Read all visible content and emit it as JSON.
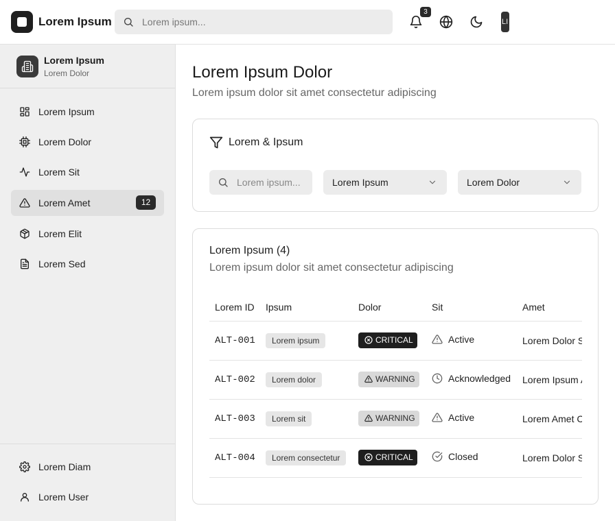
{
  "app": {
    "title": "Lorem Ipsum"
  },
  "search": {
    "placeholder": "Lorem ipsum..."
  },
  "topbar": {
    "notification_count": "3",
    "avatar_initials": "LI"
  },
  "sidebar": {
    "org": {
      "name": "Lorem Ipsum",
      "subtitle": "Lorem Dolor"
    },
    "items": [
      {
        "label": "Lorem Ipsum",
        "icon": "dashboard-icon"
      },
      {
        "label": "Lorem Dolor",
        "icon": "chip-icon"
      },
      {
        "label": "Lorem Sit",
        "icon": "activity-icon"
      },
      {
        "label": "Lorem Amet",
        "icon": "alert-triangle-icon",
        "badge": "12",
        "active": true
      },
      {
        "label": "Lorem Elit",
        "icon": "package-icon"
      },
      {
        "label": "Lorem Sed",
        "icon": "document-icon"
      }
    ],
    "bottom_items": [
      {
        "label": "Lorem Diam",
        "icon": "gear-icon"
      },
      {
        "label": "Lorem User",
        "icon": "user-icon"
      }
    ]
  },
  "page": {
    "title": "Lorem Ipsum Dolor",
    "subtitle": "Lorem ipsum dolor sit amet consectetur adipiscing"
  },
  "filters": {
    "title": "Lorem & Ipsum",
    "search_placeholder": "Lorem ipsum...",
    "select1": "Lorem Ipsum",
    "select2": "Lorem Dolor"
  },
  "table": {
    "title": "Lorem Ipsum (4)",
    "subtitle": "Lorem ipsum dolor sit amet consectetur adipiscing",
    "headers": [
      "Lorem ID",
      "Ipsum",
      "Dolor",
      "Sit",
      "Amet"
    ],
    "rows": [
      {
        "id": "ALT-001",
        "tag": "Lorem ipsum",
        "severity": "CRITICAL",
        "status": "Active",
        "amet": "Lorem Dolor Sit"
      },
      {
        "id": "ALT-002",
        "tag": "Lorem dolor",
        "severity": "WARNING",
        "status": "Acknowledged",
        "amet": "Lorem Ipsum Amet"
      },
      {
        "id": "ALT-003",
        "tag": "Lorem sit",
        "severity": "WARNING",
        "status": "Active",
        "amet": "Lorem Amet Consectetur"
      },
      {
        "id": "ALT-004",
        "tag": "Lorem consectetur",
        "severity": "CRITICAL",
        "status": "Closed",
        "amet": "Lorem Dolor Sit"
      }
    ]
  }
}
